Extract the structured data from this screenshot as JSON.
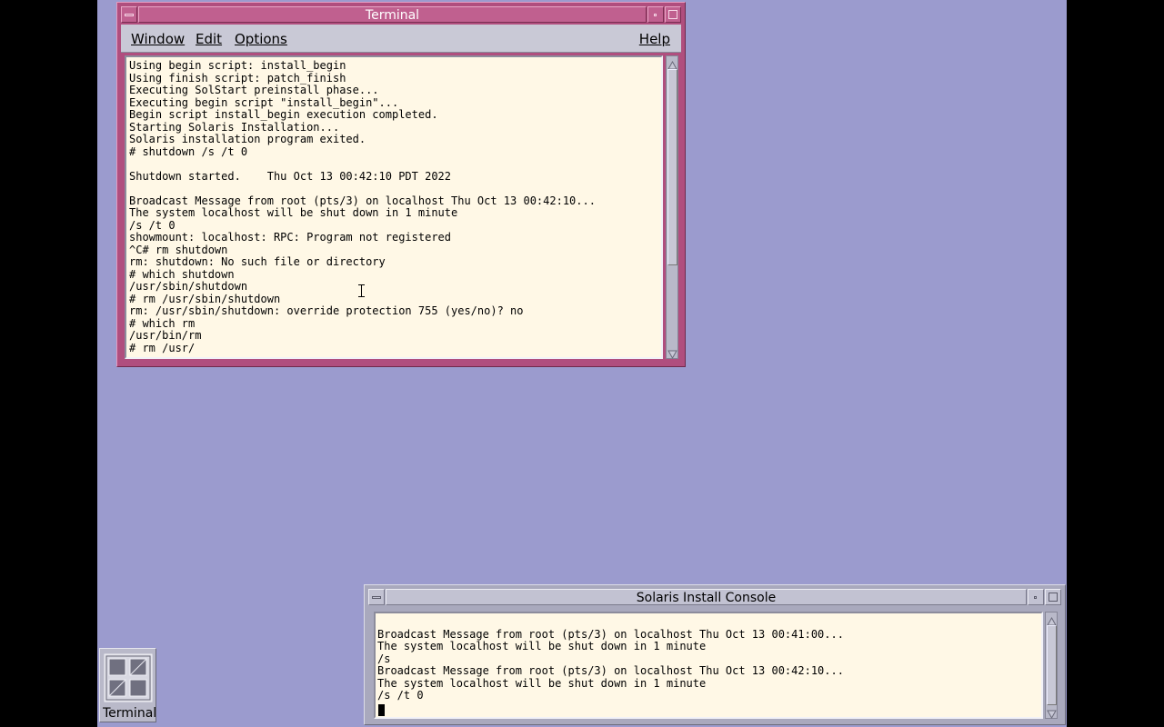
{
  "terminal_window": {
    "title": "Terminal",
    "menu": {
      "window": "Window",
      "edit": "Edit",
      "options": "Options",
      "help": "Help"
    },
    "lines": [
      "Using begin script: install_begin",
      "Using finish script: patch_finish",
      "Executing SolStart preinstall phase...",
      "Executing begin script \"install_begin\"...",
      "Begin script install_begin execution completed.",
      "Starting Solaris Installation...",
      "Solaris installation program exited.",
      "# shutdown /s /t 0",
      "",
      "Shutdown started.    Thu Oct 13 00:42:10 PDT 2022",
      "",
      "Broadcast Message from root (pts/3) on localhost Thu Oct 13 00:42:10...",
      "The system localhost will be shut down in 1 minute",
      "/s /t 0",
      "showmount: localhost: RPC: Program not registered",
      "^C# rm shutdown",
      "rm: shutdown: No such file or directory",
      "# which shutdown",
      "/usr/sbin/shutdown",
      "# rm /usr/sbin/shutdown",
      "rm: /usr/sbin/shutdown: override protection 755 (yes/no)? no",
      "# which rm",
      "/usr/bin/rm",
      "# rm /usr/"
    ]
  },
  "console_window": {
    "title": "Solaris Install Console",
    "lines": [
      "",
      "Broadcast Message from root (pts/3) on localhost Thu Oct 13 00:41:00...",
      "The system localhost will be shut down in 1 minute",
      "/s",
      "Broadcast Message from root (pts/3) on localhost Thu Oct 13 00:42:10...",
      "The system localhost will be shut down in 1 minute",
      "/s /t 0"
    ]
  },
  "desktop_icon": {
    "label": "Terminal",
    "icon": "terminal-window-icon"
  },
  "colors": {
    "desktop": "#9b9bce",
    "active_frame": "#b04e7e",
    "inactive_frame": "#a9a9bd",
    "text_bg": "#fff8e6"
  }
}
